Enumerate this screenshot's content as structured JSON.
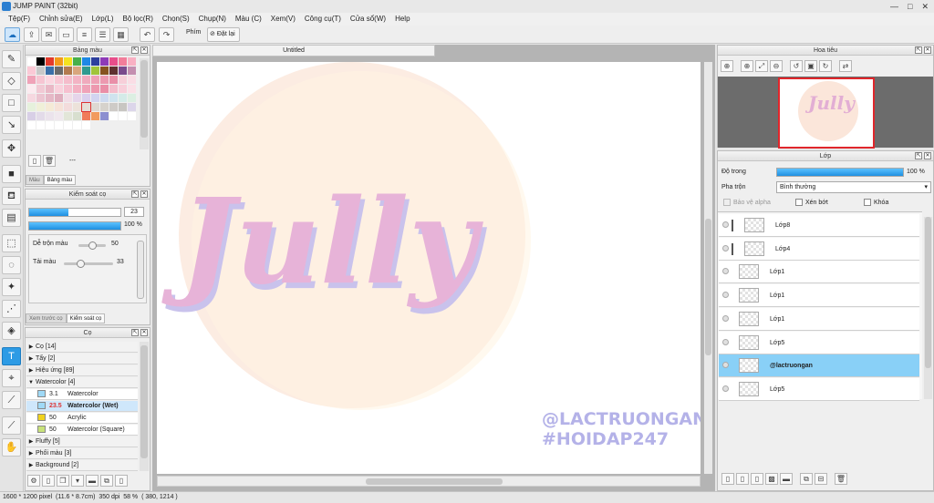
{
  "window": {
    "title": "JUMP PAINT (32bit)",
    "controls": [
      "—",
      "□",
      "✕"
    ]
  },
  "menu": [
    "Tệp(F)",
    "Chỉnh sửa(E)",
    "Lớp(L)",
    "Bộ lọc(R)",
    "Chọn(S)",
    "Chụp(N)",
    "Màu (C)",
    "Xem(V)",
    "Công cụ(T)",
    "Cửa sổ(W)",
    "Help"
  ],
  "toolbar": {
    "key_label": "Phím",
    "reset_label": "Đặt lại"
  },
  "color_panel": {
    "title": "Bảng màu",
    "count_label": "---",
    "tabs": [
      "Màu",
      "Bảng màu"
    ],
    "swatches": [
      "#ffffff",
      "#000000",
      "#e33a2c",
      "#f39a1a",
      "#f4e21f",
      "#48b04a",
      "#1e88e5",
      "#2d3f9e",
      "#8e3ab8",
      "#e84d8a",
      "#f27d9a",
      "#f9b0c3",
      "#fbc9d6",
      "#c8c8c8",
      "#3a6fa8",
      "#6a6a6a",
      "#b37a4f",
      "#d9a67e",
      "#2f9a8f",
      "#a0c43a",
      "#86521f",
      "#5f2f2f",
      "#7a4a8c",
      "#c48fb0",
      "#f0a2b8",
      "#f6c5d2",
      "#fbd6e0",
      "#f8c7d4",
      "#f5bccb",
      "#f3b3c4",
      "#f0aabd",
      "#eea1b6",
      "#ec99b0",
      "#e98fa8",
      "#f7cfd9",
      "#fadde5",
      "#fcebf0",
      "#f1c9d4",
      "#e9b8c6",
      "#f9d1dc",
      "#f6c0cf",
      "#f3b1c3",
      "#f0a3b8",
      "#ed98af",
      "#ea8ea7",
      "#f4bccb",
      "#f8cfda",
      "#fbe0e7",
      "#f6d8e0",
      "#ecc5d1",
      "#e5b8c6",
      "#dfadbd",
      "#f2dde6",
      "#e6d5ea",
      "#dad0ee",
      "#d2d4f0",
      "#cddaf0",
      "#cfe3ee",
      "#d4ebe8",
      "#dcefe2",
      "#e6f1dc",
      "#f0f0d8",
      "#f5ead6",
      "#f6e2d8",
      "#f3dcdc",
      "#ece2da",
      "#e6ded6",
      "#ded8d2",
      "#d6d2cc",
      "#cecbc7",
      "#c8c6c2",
      "#dcd6ea",
      "#d8cfe6",
      "#e3dbe9",
      "#ebe3ec",
      "#f0e8ee",
      "#e2e6d8",
      "#d8dfcf",
      "#f07c5a",
      "#f29b5e",
      "#8c8fd0",
      "#ffffff",
      "#ffffff",
      "#ffffff",
      "#ffffff",
      "#ffffff",
      "#ffffff",
      "#ffffff",
      "#ffffff",
      "#ffffff",
      "#ffffff"
    ]
  },
  "brush_control": {
    "title": "Kiểm soát cọ",
    "size_value": "23",
    "size_fraction": 0.43,
    "opacity_value": "100 %",
    "opacity_fraction": 1.0,
    "blend_label": "Dễ trộn màu",
    "blend_value": "50",
    "blend_fraction": 0.5,
    "reload_label": "Tải màu",
    "reload_value": "33",
    "reload_fraction": 0.33,
    "tabs": [
      "Xem trước cọ",
      "Kiểm soát cọ"
    ]
  },
  "brush_panel": {
    "title": "Cọ",
    "categories": [
      {
        "label": "Cọ [14]",
        "expanded": false
      },
      {
        "label": "Tẩy [2]",
        "expanded": false
      },
      {
        "label": "Hiệu ứng [89]",
        "expanded": false
      },
      {
        "label": "Watercolor [4]",
        "expanded": true
      }
    ],
    "watercolor_items": [
      {
        "size": "3.1",
        "name": "Watercolor",
        "color": "#9fd9f6",
        "selected": false
      },
      {
        "size": "23.5",
        "name": "Watercolor (Wet)",
        "color": "#9fd9f6",
        "selected": true
      },
      {
        "size": "50",
        "name": "Acrylic",
        "color": "#f0d21e",
        "selected": false
      },
      {
        "size": "50",
        "name": "Watercolor (Square)",
        "color": "#c8e27a",
        "selected": false
      }
    ],
    "more_categories": [
      {
        "label": "Fluffy [5]"
      },
      {
        "label": "Phối màu [3]"
      },
      {
        "label": "Background [2]"
      }
    ]
  },
  "canvas": {
    "tab_title": "Untitled",
    "artwork_text": "Jully",
    "watermark_line1": "@LACTRUONGAN",
    "watermark_line2": "#HOIDAP247"
  },
  "navigator": {
    "title": "Hoa tiêu"
  },
  "layer_panel": {
    "title": "Lớp",
    "opacity_label": "Độ trong",
    "opacity_value": "100 %",
    "opacity_fraction": 1.0,
    "blend_label": "Pha trộn",
    "blend_value": "Bình thường",
    "checkboxes": [
      "Bảo vệ alpha",
      "Xén bớt",
      "Khóa"
    ],
    "layers": [
      {
        "name": "Lớp8",
        "clipped": true,
        "selected": false
      },
      {
        "name": "Lớp4",
        "clipped": true,
        "selected": false
      },
      {
        "name": "Lớp1",
        "clipped": false,
        "selected": false
      },
      {
        "name": "Lớp1",
        "clipped": false,
        "selected": false
      },
      {
        "name": "Lớp1",
        "clipped": false,
        "selected": false
      },
      {
        "name": "Lớp5",
        "clipped": false,
        "selected": false
      },
      {
        "name": "@lactruongan",
        "clipped": false,
        "selected": true
      },
      {
        "name": "Lớp5",
        "clipped": false,
        "selected": false
      }
    ]
  },
  "status": {
    "dimensions": "1600 * 1200 pixel",
    "physical": "(11.6 * 8.7cm)",
    "dpi": "350 dpi",
    "zoom": "58 %",
    "cursor": "( 380, 1214 )"
  }
}
